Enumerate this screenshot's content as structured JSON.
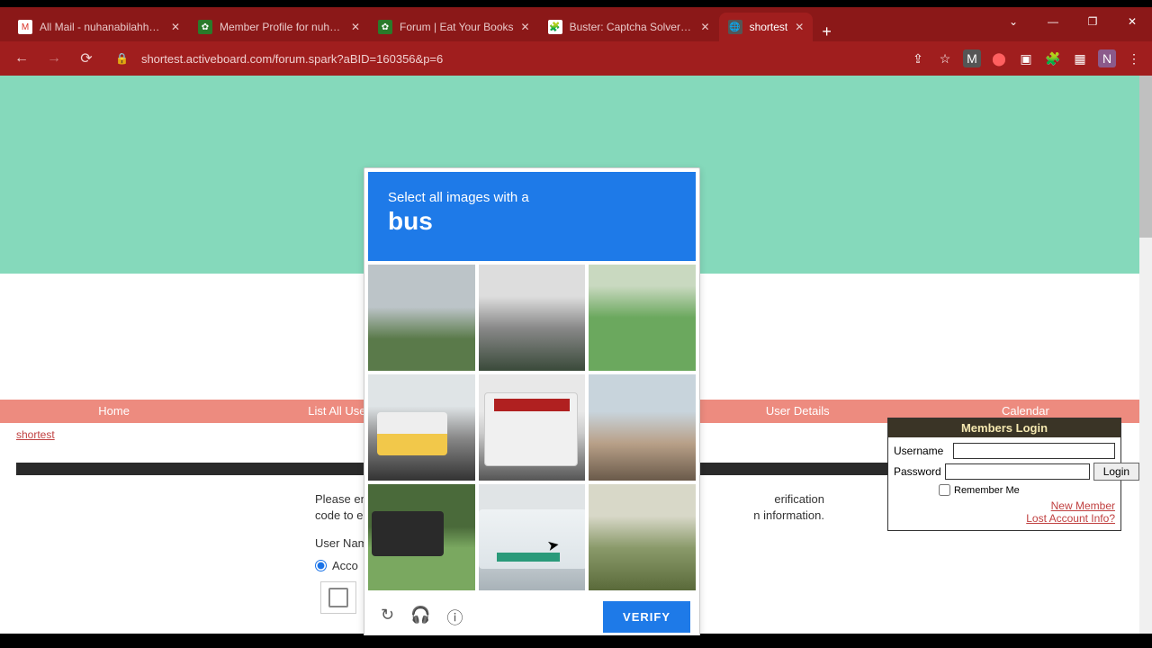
{
  "browser": {
    "tabs": [
      {
        "title": "All Mail - nuhanabilahhaik@",
        "favicon": "M"
      },
      {
        "title": "Member Profile for nuhanab",
        "favicon": "🍃"
      },
      {
        "title": "Forum | Eat Your Books",
        "favicon": "🍃"
      },
      {
        "title": "Buster: Captcha Solver for H",
        "favicon": "🧩"
      },
      {
        "title": "shortest",
        "favicon": "◯"
      }
    ],
    "active_tab": 4,
    "url": "shortest.activeboard.com/forum.spark?aBID=160356&p=6",
    "window_controls": {
      "minimize": "—",
      "maximize": "❐",
      "close": "✕"
    },
    "nav": {
      "back": "←",
      "forward": "→",
      "reload": "⟳"
    },
    "add_tab": "+",
    "extensions": [
      "↗",
      "☆",
      "M",
      "●",
      "▣",
      "🧩",
      "▦",
      "N",
      "⋮"
    ]
  },
  "login": {
    "header": "Members Login",
    "user_label": "Username",
    "pass_label": "Password",
    "login_btn": "Login",
    "remember": "Remember Me",
    "links": {
      "new": "New Member",
      "lost": "Lost Account Info?"
    }
  },
  "nav_menu": [
    "Home",
    "List All Users",
    "",
    "User Details",
    "Calendar"
  ],
  "breadcrumb": "shortest",
  "form": {
    "intro_left": "Please en",
    "intro_right": "erification",
    "intro2_left": "code to e",
    "intro2_right": "n information.",
    "user_label": "User Nam",
    "radio_label": "Acco"
  },
  "captcha": {
    "line1": "Select all images with a",
    "subject": "bus",
    "verify": "VERIFY",
    "icons": {
      "reload": "↻",
      "audio": "🎧",
      "info": "ⓘ"
    },
    "tiles": [
      "street",
      "path",
      "lawn",
      "bus-yellow",
      "bus-white-rear",
      "construction",
      "bus-dark",
      "bus-side",
      "trees"
    ]
  }
}
